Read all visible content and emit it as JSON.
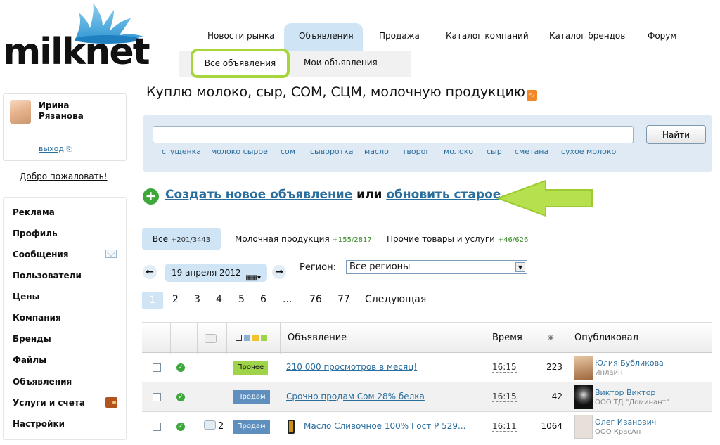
{
  "logo": {
    "text": "milknet"
  },
  "nav": {
    "items": [
      "Новости рынка",
      "Объявления",
      "Продажа",
      "Каталог компаний",
      "Каталог брендов",
      "Форум"
    ],
    "sub": [
      "Все объявления",
      "Мои объявления"
    ]
  },
  "user": {
    "first": "Ирина",
    "last": "Рязанова",
    "logout": "выход",
    "welcome": "Добро пожаловать!"
  },
  "menu": [
    "Реклама",
    "Профиль",
    "Сообщения",
    "Пользователи",
    "Цены",
    "Компания",
    "Бренды",
    "Файлы",
    "Объявления",
    "Услуги и счета",
    "Настройки"
  ],
  "headline": "Куплю молоко, сыр, СОМ, СЦМ, молочную продукцию",
  "search": {
    "value": "",
    "button": "Найти",
    "tags": [
      "сгущенка",
      "молоко сырое",
      "сом",
      "сыворотка",
      "масло",
      "творог",
      "молоко",
      "сыр",
      "сметана",
      "сухое молоко"
    ]
  },
  "create": {
    "link1": "Создать новое объявление",
    "mid": "или",
    "link2": "обновить старое"
  },
  "filter_tabs": [
    {
      "label": "Все",
      "count": "+201/3443"
    },
    {
      "label": "Молочная продукция",
      "count": "+155/2817"
    },
    {
      "label": "Прочие товары и услуги",
      "count": "+46/626"
    }
  ],
  "date": "19 апреля 2012",
  "region": {
    "label": "Регион:",
    "value": "Все регионы"
  },
  "pagination": {
    "pages": [
      "1",
      "2",
      "3",
      "4",
      "5",
      "6",
      "...",
      "76",
      "77"
    ],
    "next": "Следующая",
    "current": "1"
  },
  "table": {
    "headers": {
      "ad": "Объявление",
      "time": "Время",
      "published": "Опубликовал"
    },
    "rows": [
      {
        "badge": "Прочее",
        "badge_color": "#9ed34a",
        "comments": "",
        "title": "210 000 просмотров в месяц!",
        "time": "16:15",
        "views": "223",
        "user": "Юлия Бубликова",
        "sub": "Инлайн"
      },
      {
        "badge": "Продам",
        "badge_color": "#5f8fbf",
        "comments": "",
        "title": "Срочно продам Сом 28% белка",
        "time": "16:15",
        "views": "42",
        "user": "Виктор Виктор",
        "sub": "ООО ТД \"Доминант\""
      },
      {
        "badge": "Продам",
        "badge_color": "#5f8fbf",
        "comments": "2",
        "title": "Масло Сливочное 100% Гост Р 529...",
        "time": "16:11",
        "views": "1064",
        "user": "Олег Иванович",
        "sub": "ООО КрасАн"
      }
    ]
  },
  "colors": {
    "accent": "#2a6e9e",
    "tab_bg": "#cfe4f5",
    "highlight": "#a6d63c",
    "ok": "#3ea73b"
  }
}
